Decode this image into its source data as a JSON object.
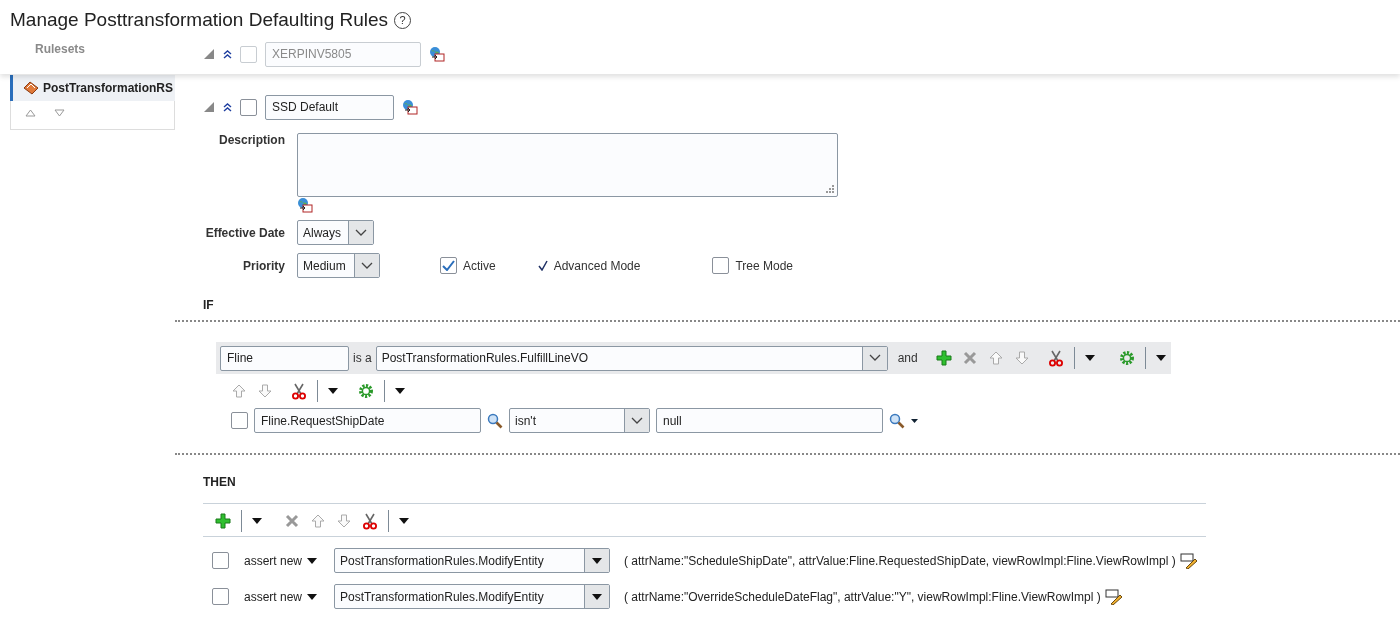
{
  "page": {
    "title": "Manage Posttransformation Defaulting Rules",
    "help": "?"
  },
  "background": {
    "rulesets_label": "Rulesets",
    "rule_name": "XERPINV5805",
    "rule_checked": false
  },
  "sidebar": {
    "items": [
      {
        "label": "PostTransformationRS",
        "selected": true
      }
    ]
  },
  "rule": {
    "expanded": true,
    "checked": false,
    "name": "SSD Default",
    "description_label": "Description",
    "effective_date": {
      "label": "Effective Date",
      "value": "Always"
    },
    "priority": {
      "label": "Priority",
      "value": "Medium"
    },
    "options": [
      {
        "kind": "checkbox",
        "label": "Active",
        "checked": true
      },
      {
        "kind": "tick",
        "label": "Advanced Mode",
        "checked": true
      },
      {
        "kind": "checkbox",
        "label": "Tree Mode",
        "checked": false
      }
    ]
  },
  "if": {
    "heading": "IF",
    "fact": {
      "variable": "Fline",
      "connector": "is a",
      "type": "PostTransformationRules.FulfillLineVO",
      "joiner": "and"
    },
    "conditions": [
      {
        "checked": false,
        "left": "Fline.RequestShipDate",
        "operator": "isn't",
        "right": "null"
      }
    ]
  },
  "then": {
    "heading": "THEN",
    "actions": [
      {
        "checked": false,
        "verb": "assert new",
        "target": "PostTransformationRules.ModifyEntity",
        "arguments": "( attrName:\"ScheduleShipDate\", attrValue:Fline.RequestedShipDate, viewRowImpl:Fline.ViewRowImpl )"
      },
      {
        "checked": false,
        "verb": "assert new",
        "target": "PostTransformationRules.ModifyEntity",
        "arguments": "( attrName:\"OverrideScheduleDateFlag\", attrValue:\"Y\", viewRowImpl:Fline.ViewRowImpl )"
      }
    ]
  }
}
